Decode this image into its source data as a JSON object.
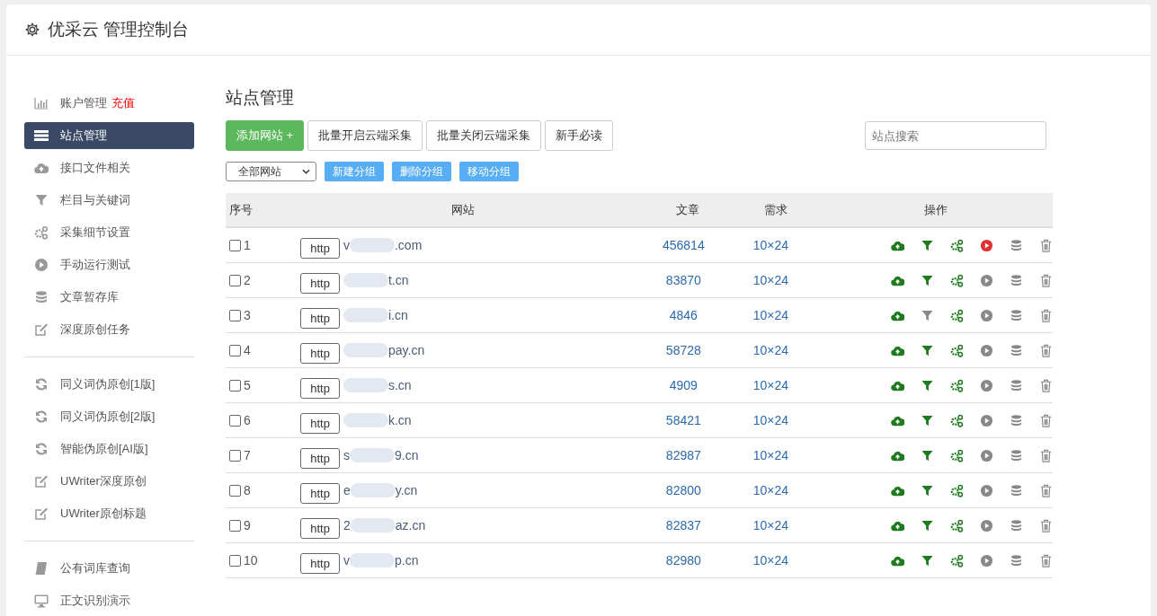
{
  "window": {
    "title": "优采云 管理控制台"
  },
  "sidebar": {
    "groups": [
      {
        "items": [
          {
            "kind": "chart",
            "label": "账户管理",
            "badge": "充值",
            "selected": false
          },
          {
            "kind": "list",
            "label": "站点管理",
            "selected": true
          },
          {
            "kind": "cloud",
            "label": "接口文件相关",
            "selected": false
          },
          {
            "kind": "filter",
            "label": "栏目与关键词",
            "selected": false
          },
          {
            "kind": "gears",
            "label": "采集细节设置",
            "selected": false
          },
          {
            "kind": "play",
            "label": "手动运行测试",
            "selected": false
          },
          {
            "kind": "db",
            "label": "文章暂存库",
            "selected": false
          },
          {
            "kind": "edit",
            "label": "深度原创任务",
            "selected": false
          }
        ]
      },
      {
        "items": [
          {
            "kind": "refresh",
            "label": "同义词伪原创[1版]",
            "selected": false
          },
          {
            "kind": "refresh",
            "label": "同义词伪原创[2版]",
            "selected": false
          },
          {
            "kind": "refresh",
            "label": "智能伪原创[AI版]",
            "selected": false
          },
          {
            "kind": "edit",
            "label": "UWriter深度原创",
            "selected": false
          },
          {
            "kind": "edit",
            "label": "UWriter原创标题",
            "selected": false
          }
        ]
      },
      {
        "items": [
          {
            "kind": "book",
            "label": "公有词库查询",
            "selected": false
          },
          {
            "kind": "monitor",
            "label": "正文识别演示",
            "selected": false
          }
        ]
      }
    ]
  },
  "main": {
    "title": "站点管理",
    "toolbar": [
      {
        "kind": "primary",
        "label": "添加网站 +"
      },
      {
        "kind": "default",
        "label": "批量开启云端采集"
      },
      {
        "kind": "default",
        "label": "批量关闭云端采集"
      },
      {
        "kind": "default",
        "label": "新手必读"
      }
    ],
    "search": {
      "placeholder": "站点搜索"
    },
    "group_select": {
      "value": "全部网站"
    },
    "group_buttons": [
      "新建分组",
      "删除分组",
      "移动分组"
    ],
    "table": {
      "columns": [
        "序号",
        "网站",
        "文章",
        "需求",
        "操作"
      ],
      "rows": [
        {
          "index": "1",
          "checked": false,
          "protocol": "http",
          "domain_start": "v",
          "domain_end": ".com",
          "articles": "456814",
          "demand": "10×24",
          "filter_on": true,
          "running": true
        },
        {
          "index": "2",
          "checked": false,
          "protocol": "http",
          "domain_start": "",
          "domain_end": "t.cn",
          "articles": "83870",
          "demand": "10×24",
          "filter_on": true,
          "running": false
        },
        {
          "index": "3",
          "checked": false,
          "protocol": "http",
          "domain_start": "",
          "domain_end": "i.cn",
          "articles": "4846",
          "demand": "10×24",
          "filter_on": false,
          "running": false
        },
        {
          "index": "4",
          "checked": false,
          "protocol": "http",
          "domain_start": "",
          "domain_end": "pay.cn",
          "articles": "58728",
          "demand": "10×24",
          "filter_on": true,
          "running": false
        },
        {
          "index": "5",
          "checked": false,
          "protocol": "http",
          "domain_start": "",
          "domain_end": "s.cn",
          "articles": "4909",
          "demand": "10×24",
          "filter_on": true,
          "running": false
        },
        {
          "index": "6",
          "checked": false,
          "protocol": "http",
          "domain_start": "",
          "domain_end": "k.cn",
          "articles": "58421",
          "demand": "10×24",
          "filter_on": true,
          "running": false
        },
        {
          "index": "7",
          "checked": false,
          "protocol": "http",
          "domain_start": "s",
          "domain_end": "9.cn",
          "articles": "82987",
          "demand": "10×24",
          "filter_on": true,
          "running": false
        },
        {
          "index": "8",
          "checked": false,
          "protocol": "http",
          "domain_start": "e",
          "domain_end": "y.cn",
          "articles": "82800",
          "demand": "10×24",
          "filter_on": true,
          "running": false
        },
        {
          "index": "9",
          "checked": false,
          "protocol": "http",
          "domain_start": "2",
          "domain_end": "az.cn",
          "articles": "82837",
          "demand": "10×24",
          "filter_on": true,
          "running": false
        },
        {
          "index": "10",
          "checked": false,
          "protocol": "http",
          "domain_start": "v",
          "domain_end": "p.cn",
          "articles": "82980",
          "demand": "10×24",
          "filter_on": true,
          "running": false
        }
      ]
    }
  }
}
